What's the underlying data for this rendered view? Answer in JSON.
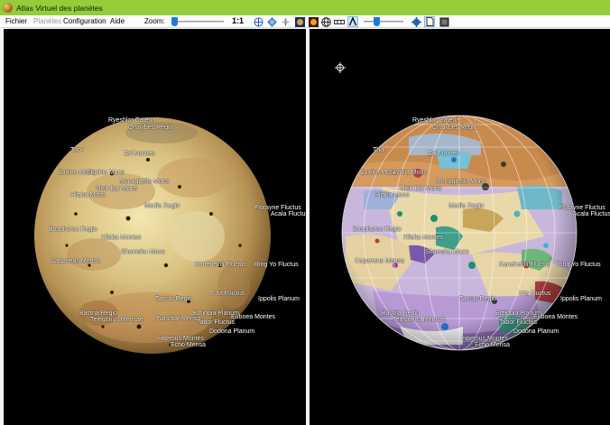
{
  "window": {
    "title": "Atlas Virtuel des planètes"
  },
  "menu": [
    {
      "label": "Fichier",
      "enabled": true
    },
    {
      "label": "Planètes",
      "enabled": false
    },
    {
      "label": "Configuration",
      "enabled": true
    },
    {
      "label": "Aide",
      "enabled": true
    }
  ],
  "toolbar": {
    "zoom_label": "Zoom:",
    "zoom_level": 0.0,
    "ratio_label": "1:1",
    "opacity_level": 0.3,
    "icons": [
      "globe-orientation-icon",
      "rotate-icon",
      "compass-icon",
      "io-texture-icon",
      "sun-icon",
      "grid-icon",
      "scale-bar-icon",
      "label-icon",
      "settings-icon",
      "document-icon",
      "screen-icon"
    ]
  },
  "colors": {
    "titlebar": "#94cc3a",
    "accent": "#1f7ad8"
  },
  "left_view": {
    "labels": [
      "Ryeshlor Catena",
      "Chalybes Regio",
      "Zal Montes",
      "Thor",
      "Euxine Mons",
      "Skythia Mons",
      "Monogbello Mons",
      "Gish Bar Mons",
      "Hiiaka Mons",
      "Media Regio",
      "Florayne Fluctus",
      "Acala Fluctus",
      "Bosphorus Regio",
      "Hiiaka Montes",
      "Shamshu Mons",
      "Capaneus Mensa",
      "Kanehekili Fluctus",
      "Ring Yo Fluctus",
      "Tarsus Regio",
      "Uta Fluctus",
      "Tvashtar Mensa",
      "Ippolis Planum",
      "Bactria Regio",
      "Ethiopia Planum",
      "Telegonus Mensae",
      "Euboea Montes",
      "Tabor Fluctus",
      "Dodona Planum",
      "Haemus Montes",
      "Echo Mensa"
    ]
  },
  "right_view": {
    "labels": [
      "Ryeshlor Catena",
      "Chalybes Regio",
      "Zal Montes",
      "Thor",
      "Euxine Mons",
      "Skythia Mons",
      "Monogbello Mons",
      "Gish Bar Mons",
      "Hiiaka Mons",
      "Media Regio",
      "Florayne Fluctus",
      "Acala Fluctus",
      "Bosphorus Regio",
      "Hiiaka Montes",
      "Shamshu Mons",
      "Capaneus Mensa",
      "Kanehekili Fluctus",
      "Ring Yo Fluctus",
      "Tarsus Regio",
      "Uta Fluctus",
      "Ippolis Planum",
      "Bactria Regio",
      "Ethiopia Planum",
      "Telegonus Mensae",
      "Euboea Montes",
      "Tabor Fluctus",
      "Dodona Planum",
      "Haemus Montes",
      "Echo Mensa"
    ]
  }
}
